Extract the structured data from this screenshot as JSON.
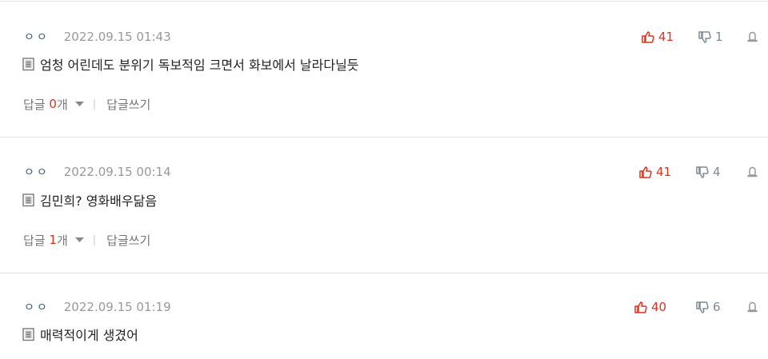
{
  "comments": [
    {
      "nickname": "ㅇㅇ",
      "date": "2022.09.15 01:43",
      "likes": "41",
      "dislikes": "1",
      "text": "엄청 어린데도 분위기 독보적임 크면서 화보에서 날라다닐듯",
      "reply_label": "답글",
      "reply_count": "0",
      "reply_unit": "개",
      "write_label": "답글쓰기"
    },
    {
      "nickname": "ㅇㅇ",
      "date": "2022.09.15 00:14",
      "likes": "41",
      "dislikes": "4",
      "text": "김민희? 영화배우닮음",
      "reply_label": "답글",
      "reply_count": "1",
      "reply_unit": "개",
      "write_label": "답글쓰기"
    },
    {
      "nickname": "ㅇㅇ",
      "date": "2022.09.15 01:19",
      "likes": "40",
      "dislikes": "6",
      "text": "매력적이게 생겼어"
    }
  ],
  "colors": {
    "like": "#e0311b",
    "dislike": "#7c8a96",
    "nickname": "#2a5a8a",
    "divider": "#e2e2e2"
  },
  "icons": [
    "thumbs-up-icon",
    "thumbs-down-icon",
    "report-icon",
    "document-icon",
    "caret-down-icon"
  ]
}
